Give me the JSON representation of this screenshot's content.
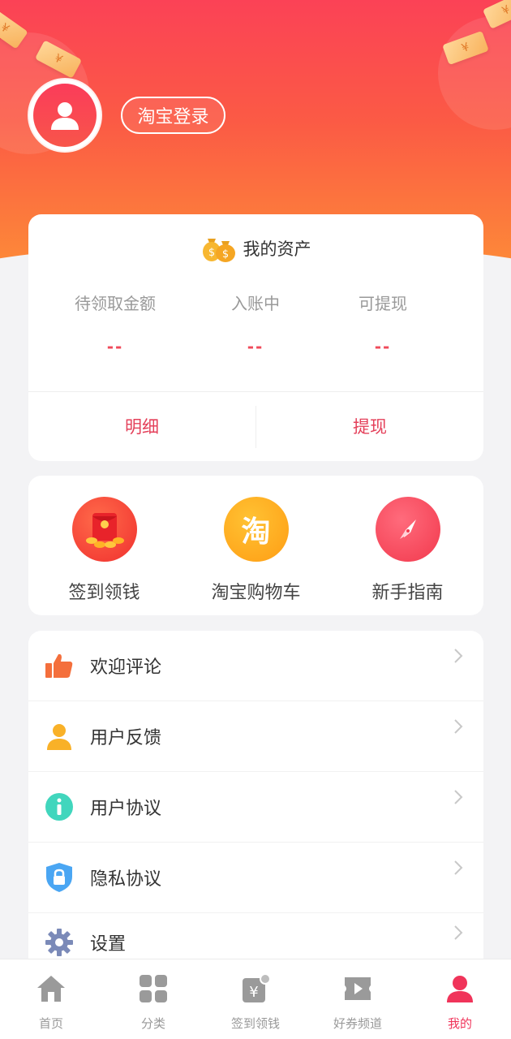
{
  "header": {
    "login_label": "淘宝登录",
    "note_symbol": "¥",
    "gradient_top": "#fb4256",
    "gradient_bottom": "#fd8a38"
  },
  "assets": {
    "title": "我的资产",
    "icon": "money-bag-icon",
    "columns": [
      {
        "label": "待领取金额",
        "value": "--"
      },
      {
        "label": "入账中",
        "value": "--"
      },
      {
        "label": "可提现",
        "value": "--"
      }
    ],
    "actions": {
      "detail": "明细",
      "withdraw": "提现"
    }
  },
  "shortcuts": [
    {
      "label": "签到领钱",
      "icon": "red-envelope-icon"
    },
    {
      "label": "淘宝购物车",
      "icon": "taobao-icon",
      "glyph": "淘"
    },
    {
      "label": "新手指南",
      "icon": "compass-icon"
    }
  ],
  "menu": [
    {
      "label": "欢迎评论",
      "icon": "thumbs-up-icon"
    },
    {
      "label": "用户反馈",
      "icon": "user-icon"
    },
    {
      "label": "用户协议",
      "icon": "info-icon"
    },
    {
      "label": "隐私协议",
      "icon": "lock-shield-icon"
    },
    {
      "label": "设置",
      "icon": "gear-icon"
    }
  ],
  "tabbar": [
    {
      "label": "首页",
      "icon": "home-icon",
      "active": false
    },
    {
      "label": "分类",
      "icon": "grid-icon",
      "active": false
    },
    {
      "label": "签到领钱",
      "icon": "coupon-yen-icon",
      "active": false
    },
    {
      "label": "好券频道",
      "icon": "video-ticket-icon",
      "active": false
    },
    {
      "label": "我的",
      "icon": "profile-icon",
      "active": true
    }
  ],
  "colors": {
    "accent": "#e4405a",
    "active_tab": "#f0345a",
    "page_bg": "#f3f3f5"
  }
}
